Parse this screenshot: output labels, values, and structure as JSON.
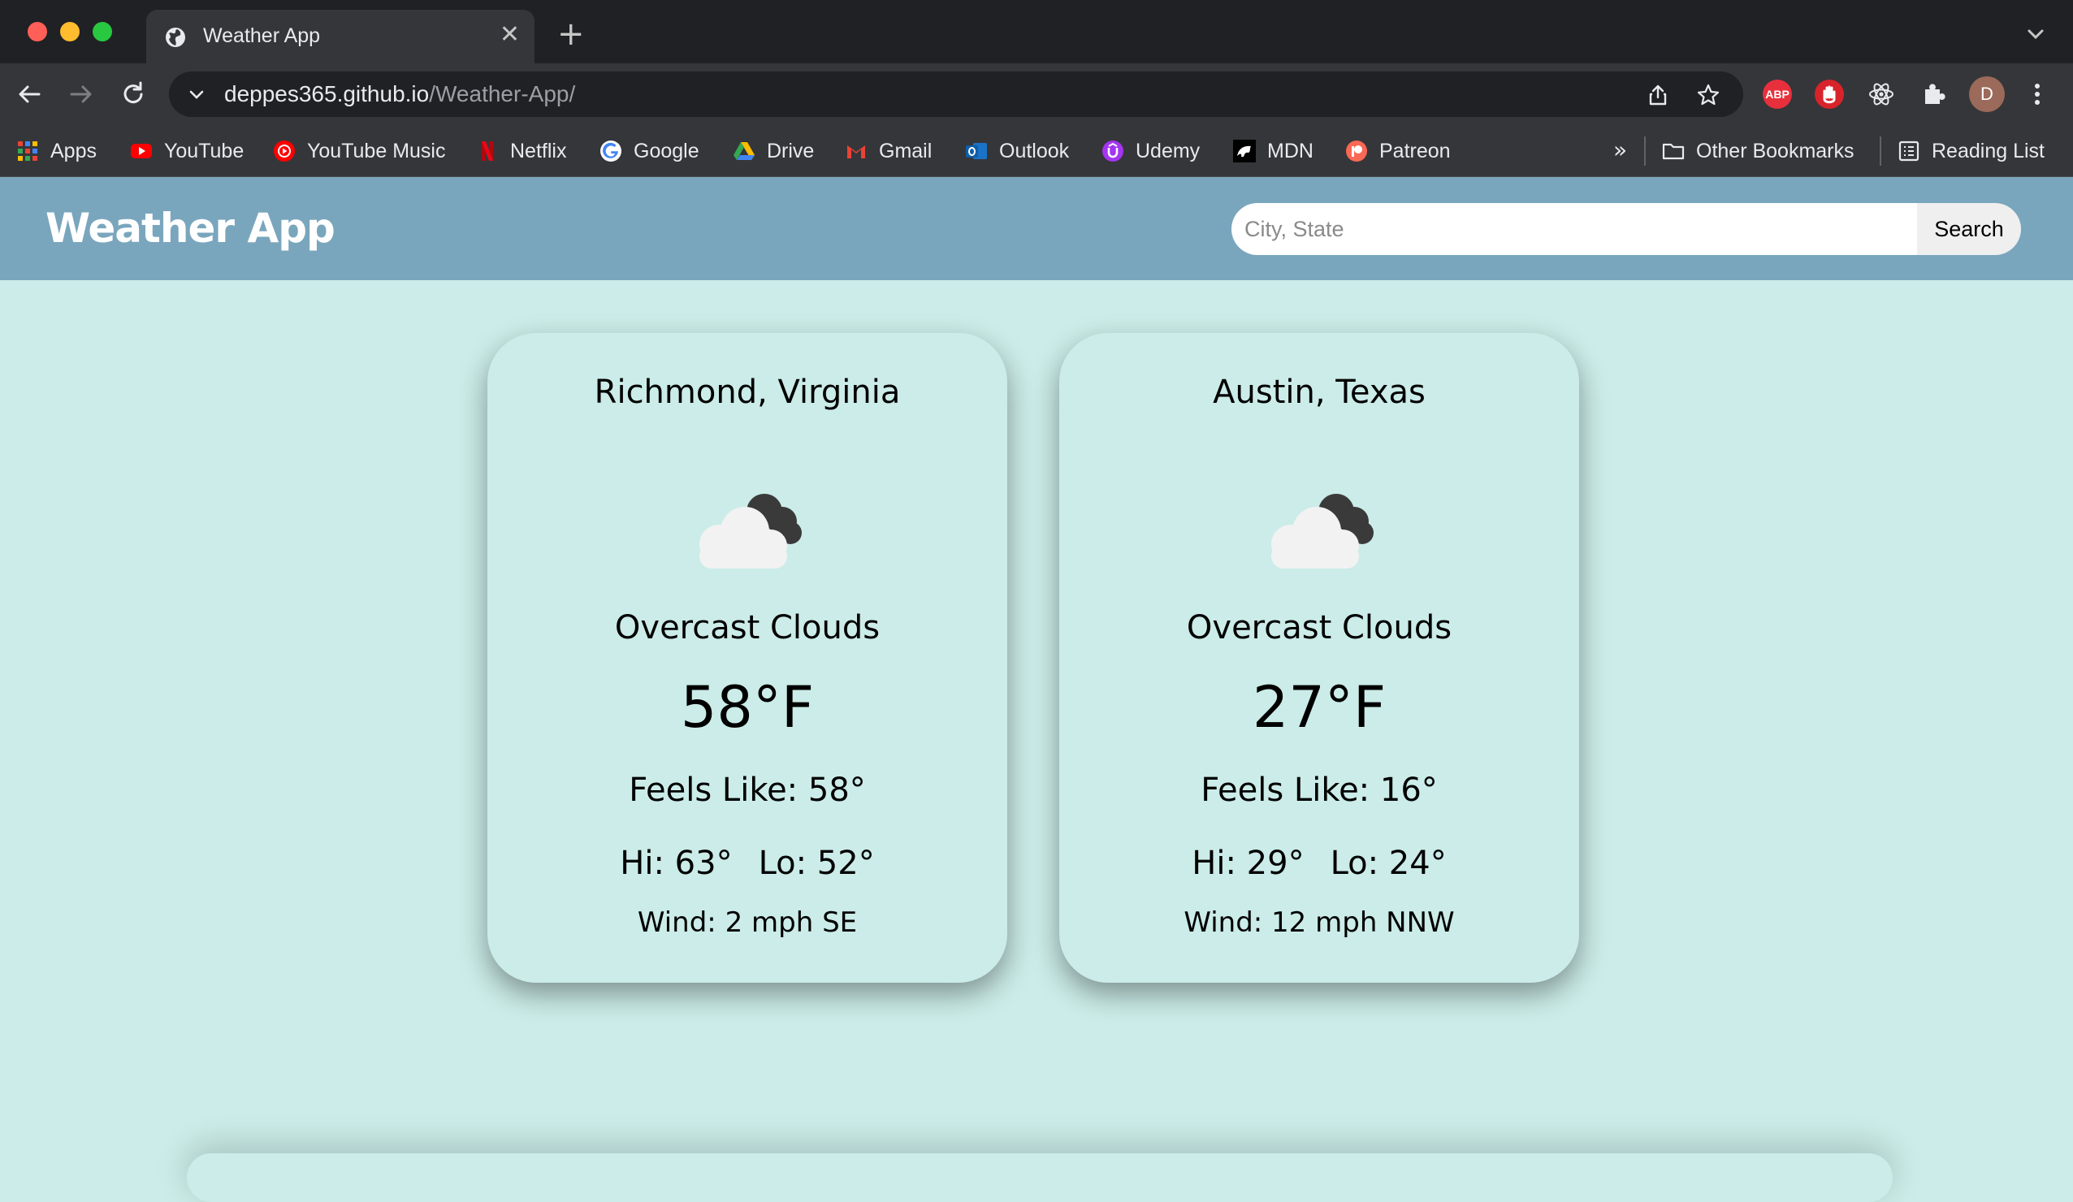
{
  "browser": {
    "tab": {
      "title": "Weather App",
      "icon": "globe-icon"
    },
    "address": {
      "host": "deppes365.github.io",
      "path": "/Weather-App/"
    },
    "extensions": [
      "adblock-plus-icon",
      "stop-hand-icon",
      "react-devtools-icon",
      "puzzle-icon"
    ],
    "extension_abp_label": "ABP",
    "profile_initial": "D",
    "bookmarks": [
      {
        "label": "Apps",
        "icon": "apps-grid-icon"
      },
      {
        "label": "YouTube",
        "icon": "youtube-icon"
      },
      {
        "label": "YouTube Music",
        "icon": "youtube-music-icon"
      },
      {
        "label": "Netflix",
        "icon": "netflix-icon"
      },
      {
        "label": "Google",
        "icon": "google-icon"
      },
      {
        "label": "Drive",
        "icon": "drive-icon"
      },
      {
        "label": "Gmail",
        "icon": "gmail-icon"
      },
      {
        "label": "Outlook",
        "icon": "outlook-icon"
      },
      {
        "label": "Udemy",
        "icon": "udemy-icon"
      },
      {
        "label": "MDN",
        "icon": "mdn-icon"
      },
      {
        "label": "Patreon",
        "icon": "patreon-icon"
      }
    ],
    "bookmarks_overflow": "»",
    "other_bookmarks": "Other Bookmarks",
    "reading_list": "Reading List"
  },
  "app": {
    "title": "Weather App",
    "search": {
      "placeholder": "City, State",
      "value": "",
      "button_label": "Search"
    },
    "header_color": "#7aa6bd",
    "background_color": "#cbece8"
  },
  "cards": [
    {
      "city": "Richmond, Virginia",
      "icon": "overcast-clouds-icon",
      "description": "Overcast Clouds",
      "temp": "58°F",
      "feels_like": "Feels Like: 58°",
      "hi": "Hi: 63°",
      "lo": "Lo: 52°",
      "wind": "Wind: 2 mph SE"
    },
    {
      "city": "Austin, Texas",
      "icon": "overcast-clouds-icon",
      "description": "Overcast Clouds",
      "temp": "27°F",
      "feels_like": "Feels Like: 16°",
      "hi": "Hi: 29°",
      "lo": "Lo: 24°",
      "wind": "Wind: 12 mph NNW"
    }
  ]
}
